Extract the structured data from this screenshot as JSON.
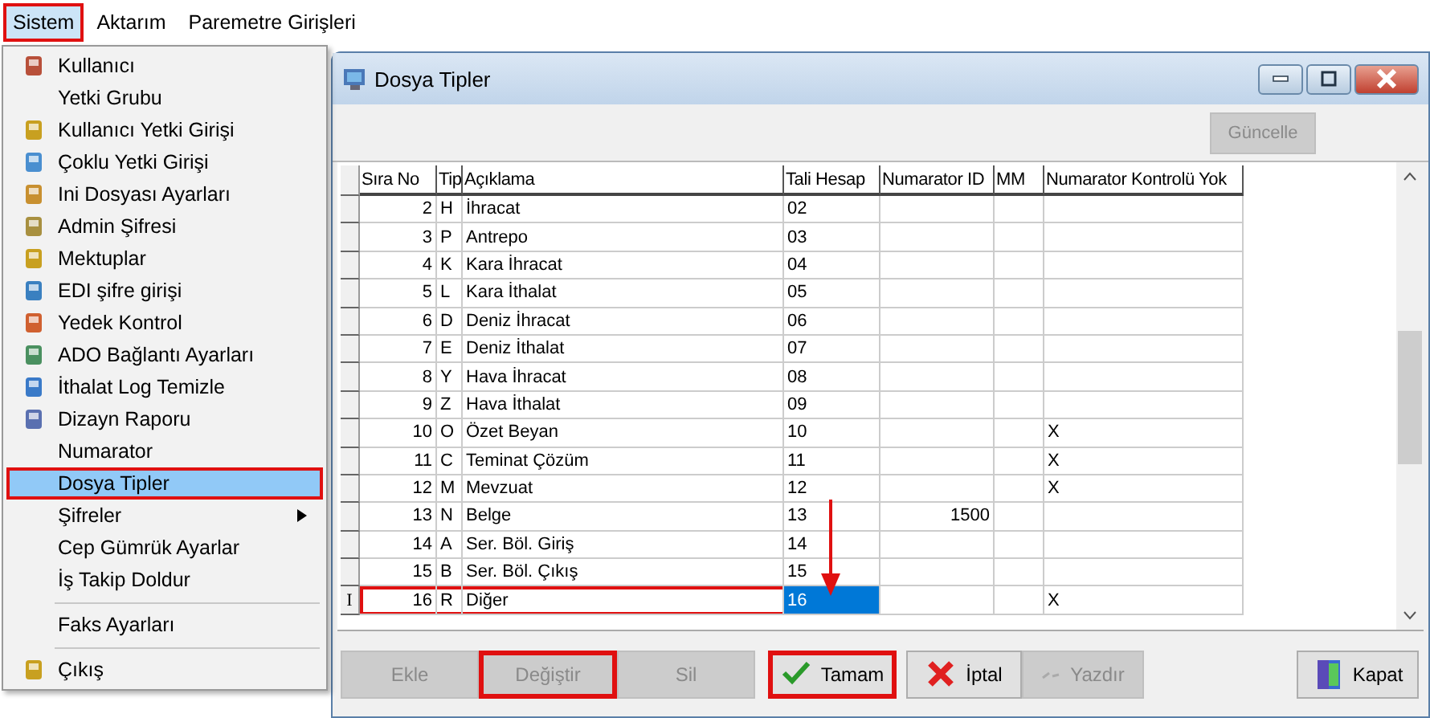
{
  "menubar": [
    {
      "label": "Sistem",
      "open": true,
      "highlighted": true
    },
    {
      "label": "Aktarım",
      "open": false,
      "highlighted": false
    },
    {
      "label": "Paremetre Girişleri",
      "open": false,
      "highlighted": false
    }
  ],
  "menu": {
    "items": [
      {
        "label": "Kullanıcı",
        "icon": true,
        "selected": false,
        "highlighted": false,
        "submenu": false,
        "separator_before": false
      },
      {
        "label": "Yetki Grubu",
        "icon": false,
        "selected": false,
        "highlighted": false,
        "submenu": false,
        "separator_before": false
      },
      {
        "label": "Kullanıcı Yetki Girişi",
        "icon": true,
        "selected": false,
        "highlighted": false,
        "submenu": false,
        "separator_before": false
      },
      {
        "label": "Çoklu Yetki Girişi",
        "icon": true,
        "selected": false,
        "highlighted": false,
        "submenu": false,
        "separator_before": false
      },
      {
        "label": "Ini Dosyası  Ayarları",
        "icon": true,
        "selected": false,
        "highlighted": false,
        "submenu": false,
        "separator_before": false
      },
      {
        "label": "Admin Şifresi",
        "icon": true,
        "selected": false,
        "highlighted": false,
        "submenu": false,
        "separator_before": false
      },
      {
        "label": "Mektuplar",
        "icon": true,
        "selected": false,
        "highlighted": false,
        "submenu": false,
        "separator_before": false
      },
      {
        "label": "EDI şifre girişi",
        "icon": true,
        "selected": false,
        "highlighted": false,
        "submenu": false,
        "separator_before": false
      },
      {
        "label": "Yedek Kontrol",
        "icon": true,
        "selected": false,
        "highlighted": false,
        "submenu": false,
        "separator_before": false
      },
      {
        "label": "ADO Bağlantı Ayarları",
        "icon": true,
        "selected": false,
        "highlighted": false,
        "submenu": false,
        "separator_before": false
      },
      {
        "label": "İthalat Log Temizle",
        "icon": true,
        "selected": false,
        "highlighted": false,
        "submenu": false,
        "separator_before": false
      },
      {
        "label": "Dizayn Raporu",
        "icon": true,
        "selected": false,
        "highlighted": false,
        "submenu": false,
        "separator_before": false
      },
      {
        "label": "Numarator",
        "icon": false,
        "selected": false,
        "highlighted": false,
        "submenu": false,
        "separator_before": false
      },
      {
        "label": "Dosya Tipler",
        "icon": false,
        "selected": true,
        "highlighted": true,
        "submenu": false,
        "separator_before": false
      },
      {
        "label": "Şifreler",
        "icon": false,
        "selected": false,
        "highlighted": false,
        "submenu": true,
        "separator_before": false
      },
      {
        "label": "Cep Gümrük Ayarlar",
        "icon": false,
        "selected": false,
        "highlighted": false,
        "submenu": false,
        "separator_before": false
      },
      {
        "label": "İş Takip Doldur",
        "icon": false,
        "selected": false,
        "highlighted": false,
        "submenu": false,
        "separator_before": false
      },
      {
        "label": "Faks Ayarları",
        "icon": false,
        "selected": false,
        "highlighted": false,
        "submenu": false,
        "separator_before": true
      },
      {
        "label": "Çıkış",
        "icon": true,
        "selected": false,
        "highlighted": false,
        "submenu": false,
        "separator_before": true
      }
    ]
  },
  "window": {
    "title": "Dosya Tipler",
    "toolbar": {
      "button": {
        "label": "Güncelle",
        "disabled": true
      }
    },
    "table": {
      "columns": [
        "Sıra No",
        "Tip",
        "Açıklama",
        "Tali Hesap",
        "Numarator ID",
        "MM",
        "Numarator Kontrolü Yok"
      ],
      "rows": [
        {
          "cells": [
            "2",
            "H",
            "İhracat",
            "02",
            "",
            "",
            ""
          ],
          "selected": false,
          "highlighted": false
        },
        {
          "cells": [
            "3",
            "P",
            "Antrepo",
            "03",
            "",
            "",
            ""
          ],
          "selected": false,
          "highlighted": false
        },
        {
          "cells": [
            "4",
            "K",
            "Kara İhracat",
            "04",
            "",
            "",
            ""
          ],
          "selected": false,
          "highlighted": false
        },
        {
          "cells": [
            "5",
            "L",
            "Kara İthalat",
            "05",
            "",
            "",
            ""
          ],
          "selected": false,
          "highlighted": false
        },
        {
          "cells": [
            "6",
            "D",
            "Deniz İhracat",
            "06",
            "",
            "",
            ""
          ],
          "selected": false,
          "highlighted": false
        },
        {
          "cells": [
            "7",
            "E",
            "Deniz İthalat",
            "07",
            "",
            "",
            ""
          ],
          "selected": false,
          "highlighted": false
        },
        {
          "cells": [
            "8",
            "Y",
            "Hava İhracat",
            "08",
            "",
            "",
            ""
          ],
          "selected": false,
          "highlighted": false
        },
        {
          "cells": [
            "9",
            "Z",
            "Hava İthalat",
            "09",
            "",
            "",
            ""
          ],
          "selected": false,
          "highlighted": false
        },
        {
          "cells": [
            "10",
            "O",
            "Özet Beyan",
            "10",
            "",
            "",
            "X"
          ],
          "selected": false,
          "highlighted": false
        },
        {
          "cells": [
            "11",
            "C",
            "Teminat Çözüm",
            "11",
            "",
            "",
            "X"
          ],
          "selected": false,
          "highlighted": false
        },
        {
          "cells": [
            "12",
            "M",
            "Mevzuat",
            "12",
            "",
            "",
            "X"
          ],
          "selected": false,
          "highlighted": false
        },
        {
          "cells": [
            "13",
            "N",
            "Belge",
            "13",
            "1500",
            "",
            ""
          ],
          "selected": false,
          "highlighted": false
        },
        {
          "cells": [
            "14",
            "A",
            "Ser. Böl. Giriş",
            "14",
            "",
            "",
            ""
          ],
          "selected": false,
          "highlighted": false
        },
        {
          "cells": [
            "15",
            "B",
            "Ser. Böl. Çıkış",
            "15",
            "",
            "",
            ""
          ],
          "selected": false,
          "highlighted": false
        },
        {
          "cells": [
            "16",
            "R",
            "Diğer",
            "16",
            "",
            "",
            "X"
          ],
          "selected": true,
          "highlighted": true,
          "indicator": "I"
        }
      ]
    },
    "buttons": [
      {
        "kind": "plain",
        "label": "Ekle",
        "disabled": true,
        "highlighted": false
      },
      {
        "kind": "plain",
        "label": "Değiştir",
        "disabled": true,
        "highlighted": true
      },
      {
        "kind": "plain",
        "label": "Sil",
        "disabled": true,
        "highlighted": false
      },
      {
        "kind": "ok",
        "label": "Tamam",
        "disabled": false,
        "highlighted": true
      },
      {
        "kind": "cancel",
        "label": "İptal",
        "disabled": false,
        "highlighted": false
      },
      {
        "kind": "print",
        "label": "Yazdır",
        "disabled": true,
        "highlighted": false
      },
      {
        "kind": "door",
        "label": "Kapat",
        "disabled": false,
        "highlighted": false
      }
    ]
  }
}
